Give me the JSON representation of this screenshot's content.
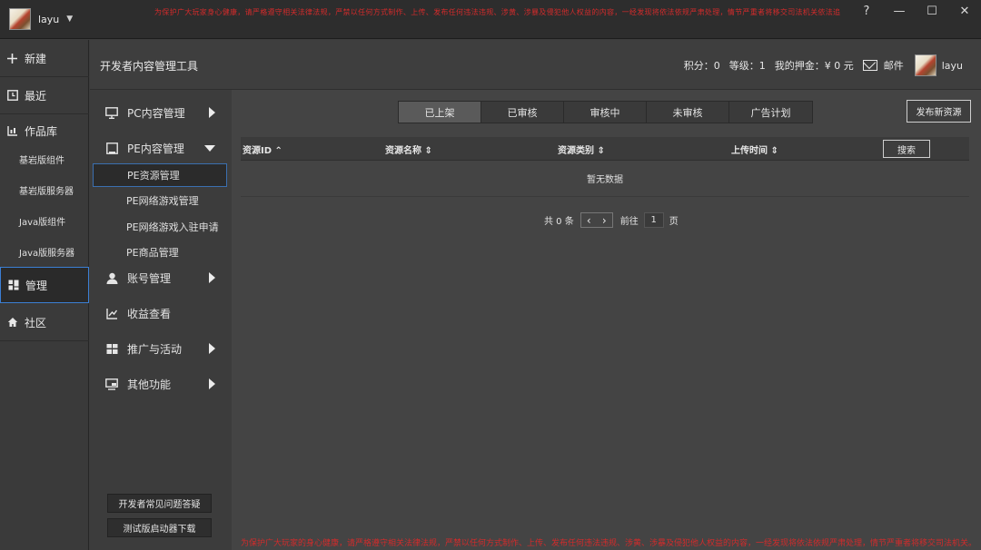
{
  "titlebar": {
    "username": "layu",
    "caret": "▼",
    "notice": "为保护广大玩家身心健康，请严格遵守相关法律法规，严禁以任何方式制作、上传、发布任何违法违规、涉黄、涉暴及侵犯他人权益的内容，一经发现将依法依规严肃处理，情节严重者将移交司法机关依法追究责任。",
    "buttons": {
      "help": "?",
      "minimize": "—",
      "maximize": "☐",
      "close": "✕"
    }
  },
  "rail": {
    "items": [
      {
        "label": "新建",
        "icon": "plus-icon"
      },
      {
        "label": "最近",
        "icon": "recent-icon"
      },
      {
        "label": "作品库",
        "icon": "library-icon"
      },
      {
        "label": "管理",
        "icon": "manage-icon"
      },
      {
        "label": "社区",
        "icon": "home-icon"
      }
    ],
    "sub_items": [
      "基岩版组件",
      "基岩版服务器",
      "Java版组件",
      "Java版服务器"
    ]
  },
  "header": {
    "title": "开发者内容管理工具",
    "points_label": "积分：0",
    "level_label": "等级：1",
    "deposit_label": "我的押金：¥ 0 元",
    "mail_label": "邮件",
    "username": "layu"
  },
  "side2": {
    "items": [
      {
        "label": "PC内容管理"
      },
      {
        "label": "PE内容管理"
      },
      {
        "label": "账号管理"
      },
      {
        "label": "收益查看"
      },
      {
        "label": "推广与活动"
      },
      {
        "label": "其他功能"
      }
    ],
    "pe_sub": [
      "PE资源管理",
      "PE网络游戏管理",
      "PE网络游戏入驻申请",
      "PE商品管理"
    ],
    "bottom_buttons": [
      "开发者常见问题答疑",
      "测试版启动器下载"
    ]
  },
  "main": {
    "tabs": [
      "已上架",
      "已审核",
      "审核中",
      "未审核",
      "广告计划"
    ],
    "active_tab": 0,
    "publish_button": "发布新资源",
    "columns": [
      "资源ID ⌃",
      "资源名称 ⇕",
      "资源类别 ⇕",
      "上传时间 ⇕"
    ],
    "search_button": "搜索",
    "empty_text": "暂无数据",
    "pager": {
      "total": "共 0 条",
      "prev": "‹",
      "next": "›",
      "goto": "前往",
      "page": "1",
      "unit": "页"
    }
  },
  "footer": {
    "notice": "为保护广大玩家的身心健康，请严格遵守相关法律法规，严禁以任何方式制作、上传、发布任何违法违规、涉黄、涉暴及侵犯他人权益的内容，一经发现将依法依规严肃处理，情节严重者将移交司法机关。"
  }
}
